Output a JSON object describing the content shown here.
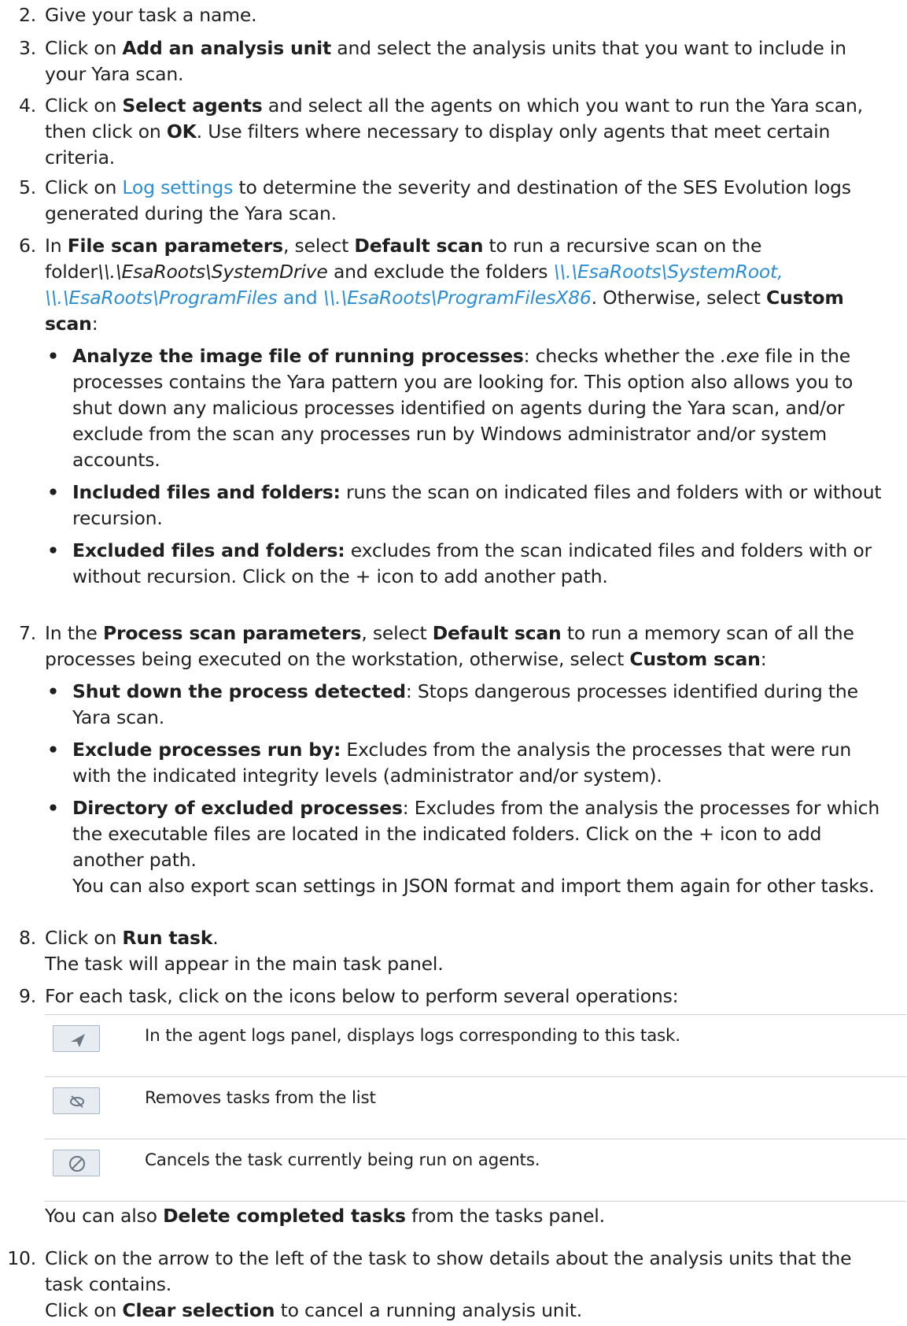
{
  "steps": [
    {
      "num": "2.",
      "text": "Give your task a name."
    },
    {
      "num": "3.",
      "pre": "Click on ",
      "bold": "Add an analysis unit",
      "post": " and select the analysis units that you want to include in your Yara scan."
    },
    {
      "num": "4.",
      "pre": "Click on ",
      "bold": "Select agents",
      "mid": " and select all the agents on which you want to run the Yara scan, then click on ",
      "bold2": "OK",
      "post": ". Use filters where necessary to display only agents that meet certain criteria."
    },
    {
      "num": "5.",
      "pre": "Click on ",
      "link": "Log settings",
      "post": " to determine the severity and destination of the SES Evolution logs generated during the Yara scan."
    },
    {
      "num": "6.",
      "p1": "In ",
      "b1": "File scan parameters",
      "p2": ", select ",
      "b2": "Default scan",
      "p3": " to run a recursive scan on the folder",
      "i1": "\\\\.\\EsaRoots\\SystemDrive",
      "p4": " and exclude the folders ",
      "l1": "\\\\.\\EsaRoots\\SystemRoot,",
      "l2": "\\\\.\\EsaRoots\\ProgramFiles",
      "l3": " and ",
      "l4": "\\\\.\\EsaRoots\\ProgramFilesX86",
      "p5": ". Otherwise, select ",
      "b3": "Custom scan",
      "p6": ":",
      "subs": [
        {
          "bold": "Analyze the image file of running processes",
          "pre": ": checks whether the ",
          "ital": ".exe",
          "post": " file in the processes contains the Yara pattern you are looking for. This option also allows you to shut down any malicious processes identified on agents during the Yara scan, and/or exclude from the scan any processes run by Windows administrator and/or system accounts."
        },
        {
          "bold": "Included files and folders:",
          "text": " runs the scan on indicated files and folders with or without recursion."
        },
        {
          "bold": "Excluded files and folders:",
          "text": " excludes from the scan indicated files and folders with or without recursion. Click on the + icon to add another path."
        }
      ]
    },
    {
      "num": "7.",
      "p1": "In the ",
      "b1": "Process scan parameters",
      "p2": ", select ",
      "b2": "Default scan",
      "p3": " to run a memory scan of all the processes being executed on the workstation, otherwise, select ",
      "b3": "Custom scan",
      "p4": ":",
      "subs": [
        {
          "bold": "Shut down the process detected",
          "text": ": Stops dangerous processes identified during the Yara scan."
        },
        {
          "bold": "Exclude processes run by:",
          "text": " Excludes from the analysis the processes that were run with the indicated integrity levels (administrator and/or system)."
        },
        {
          "bold": "Directory of excluded processes",
          "text": ": Excludes from the analysis the processes for which the executable files are located in the indicated folders. Click on the + icon to add another path.",
          "extra": "You can also export scan settings in JSON format and import them again for other tasks."
        }
      ]
    },
    {
      "num": "8.",
      "pre": "Click on ",
      "bold": "Run task",
      "post": ".",
      "line2": "The task will appear in the main task panel."
    },
    {
      "num": "9.",
      "text": "For each task, click on the icons below to perform several operations:",
      "rows": [
        {
          "icon": "send-arrow-icon",
          "desc": "In the agent logs panel, displays logs corresponding to this task."
        },
        {
          "icon": "eye-slash-icon",
          "desc": "Removes tasks from the list"
        },
        {
          "icon": "cancel-circle-icon",
          "desc": "Cancels the task currently being run on agents."
        }
      ],
      "after_pre": "You can also ",
      "after_bold": "Delete completed tasks",
      "after_post": " from the tasks panel."
    },
    {
      "num": "10.",
      "text": "Click on the arrow to the left of the task to show details about the analysis units that the task contains.",
      "pre": "Click on ",
      "bold": "Clear selection",
      "post": " to cancel a running analysis unit."
    }
  ]
}
